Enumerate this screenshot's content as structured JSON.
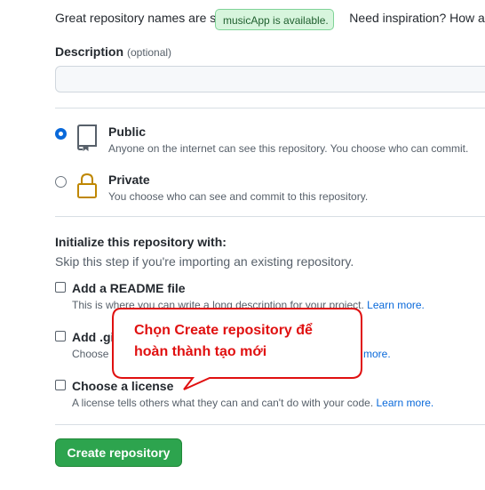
{
  "intro": {
    "text_before": "Great repository names are s",
    "text_after": "Need inspiration? How abou"
  },
  "tooltip": {
    "text": "musicApp is available."
  },
  "description": {
    "label": "Description",
    "optional": "(optional)",
    "value": ""
  },
  "visibility": {
    "public": {
      "title": "Public",
      "subtitle": "Anyone on the internet can see this repository. You choose who can commit.",
      "checked": true
    },
    "private": {
      "title": "Private",
      "subtitle": "You choose who can see and commit to this repository.",
      "checked": false
    }
  },
  "initialize": {
    "title": "Initialize this repository with:",
    "subtitle": "Skip this step if you're importing an existing repository.",
    "readme": {
      "title": "Add a README file",
      "subtitle": "This is where you can write a long description for your project.",
      "link": "Learn more."
    },
    "gitignore": {
      "title": "Add .gi",
      "subtitle": "Choose",
      "link": "more."
    },
    "license": {
      "title": "Choose a license",
      "subtitle": "A license tells others what they can and can't do with your code.",
      "link": "Learn more."
    }
  },
  "create_button": {
    "label": "Create repository"
  },
  "annotation": {
    "line1": "Chọn Create repository để",
    "line2": "hoàn thành tạo mới",
    "color": "#e01010"
  },
  "colors": {
    "primary_green": "#2da44e",
    "link_blue": "#0969da",
    "tooltip_bg": "#d7f5dd"
  }
}
